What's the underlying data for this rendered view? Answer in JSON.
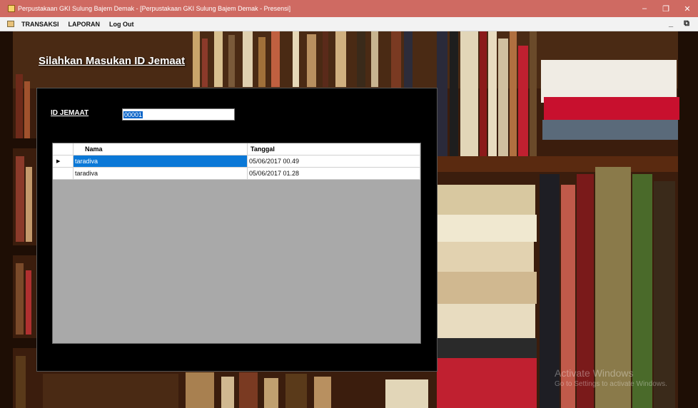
{
  "window": {
    "title": "Perpustakaan GKI Sulung Bajem Demak - [Perpustakaan GKI Sulung Bajem Demak - Presensi]",
    "minimize": "–",
    "maximize": "❐",
    "close": "✕"
  },
  "menu": {
    "items": [
      "TRANSAKSI",
      "LAPORAN",
      "Log Out"
    ],
    "mdi_controls": "_ ⧉"
  },
  "heading": "Silahkan Masukan ID Jemaat",
  "form": {
    "id_label": "ID JEMAAT",
    "id_value": "00001"
  },
  "grid": {
    "columns": [
      "Nama",
      "Tanggal"
    ],
    "rows": [
      {
        "nama": "taradiva",
        "tanggal": "05/06/2017 00.49",
        "selected": true
      },
      {
        "nama": "taradiva",
        "tanggal": "05/06/2017 01.28",
        "selected": false
      }
    ],
    "row_marker": "▶"
  },
  "watermark": {
    "line1": "Activate Windows",
    "line2": "Go to Settings to activate Windows."
  },
  "colors": {
    "titlebar": "#cf6a62",
    "selection": "#0a78d7"
  }
}
